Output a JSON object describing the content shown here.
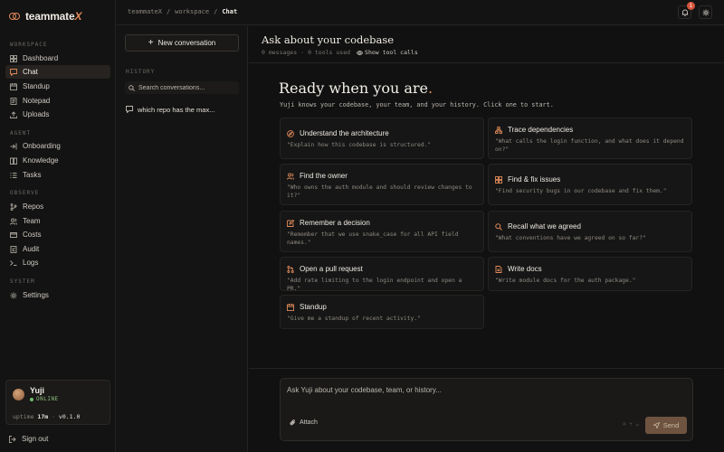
{
  "brand": {
    "name_main": "teammate",
    "name_accent": "X"
  },
  "sidebar": {
    "sections": [
      {
        "label": "WORKSPACE",
        "items": [
          {
            "label": "Dashboard",
            "icon": "dashboard-icon"
          },
          {
            "label": "Chat",
            "icon": "chat-icon",
            "active": true
          },
          {
            "label": "Standup",
            "icon": "standup-icon"
          },
          {
            "label": "Notepad",
            "icon": "notepad-icon"
          },
          {
            "label": "Uploads",
            "icon": "upload-icon"
          }
        ]
      },
      {
        "label": "AGENT",
        "items": [
          {
            "label": "Onboarding",
            "icon": "onboarding-icon"
          },
          {
            "label": "Knowledge",
            "icon": "knowledge-icon"
          },
          {
            "label": "Tasks",
            "icon": "tasks-icon"
          }
        ]
      },
      {
        "label": "OBSERVE",
        "items": [
          {
            "label": "Repos",
            "icon": "repo-icon"
          },
          {
            "label": "Team",
            "icon": "team-icon"
          },
          {
            "label": "Costs",
            "icon": "costs-icon"
          },
          {
            "label": "Audit",
            "icon": "audit-icon"
          },
          {
            "label": "Logs",
            "icon": "logs-icon"
          }
        ]
      },
      {
        "label": "SYSTEM",
        "items": [
          {
            "label": "Settings",
            "icon": "settings-icon"
          }
        ]
      }
    ],
    "user": {
      "name": "Yuji",
      "status": "ONLINE",
      "uptime_label": "uptime",
      "uptime_value": "17m",
      "version": "v0.1.0"
    },
    "signout_label": "Sign out"
  },
  "topbar": {
    "breadcrumbs": [
      "teammateX",
      "/",
      "workspace",
      "/",
      "Chat"
    ],
    "notification_count": "1"
  },
  "conversations": {
    "new_label": "New conversation",
    "history_label": "HISTORY",
    "search_placeholder": "Search conversations...",
    "items": [
      {
        "label": "which repo has the max..."
      }
    ]
  },
  "main": {
    "title": "Ask about your codebase",
    "meta_messages": "0 messages",
    "meta_sep": "·",
    "meta_tools": "0 tools used",
    "show_tools_label": "Show tool calls",
    "ready_text": "Ready when you are",
    "ready_dot": ".",
    "intro": "Yuji knows your codebase, your team, and your history. Click one to start.",
    "cards_left": [
      {
        "title": "Understand the architecture",
        "desc": "\"Explain how this codebase is structured.\"",
        "icon": "compass-icon"
      },
      {
        "title": "Find the owner",
        "desc": "\"Who owns the auth module and should review changes to it?\"",
        "icon": "users-icon"
      },
      {
        "title": "Remember a decision",
        "desc": "\"Remember that we use snake_case for all API field names.\"",
        "icon": "edit-icon"
      },
      {
        "title": "Open a pull request",
        "desc": "\"Add rate limiting to the login endpoint and open a PR.\"",
        "icon": "pull-request-icon"
      },
      {
        "title": "Standup",
        "desc": "\"Give me a standup of recent activity.\"",
        "icon": "standup-icon"
      }
    ],
    "cards_right": [
      {
        "title": "Trace dependencies",
        "desc": "\"What calls the login function, and what does it depend on?\"",
        "icon": "dependencies-icon"
      },
      {
        "title": "Find & fix issues",
        "desc": "\"Find security bugs in our codebase and fix them.\"",
        "icon": "bug-icon"
      },
      {
        "title": "Recall what we agreed",
        "desc": "\"What conventions have we agreed on so far?\"",
        "icon": "search-icon"
      },
      {
        "title": "Write docs",
        "desc": "\"Write module docs for the auth package.\"",
        "icon": "document-icon"
      }
    ],
    "composer_placeholder": "Ask Yuji about your codebase, team, or history...",
    "attach_label": "Attach",
    "shortcut_hint": "⌘ + ↵",
    "send_label": "Send"
  },
  "colors": {
    "accent": "#e08a5a",
    "background": "#111111",
    "online": "#6fc06f",
    "badge": "#d6553b"
  }
}
